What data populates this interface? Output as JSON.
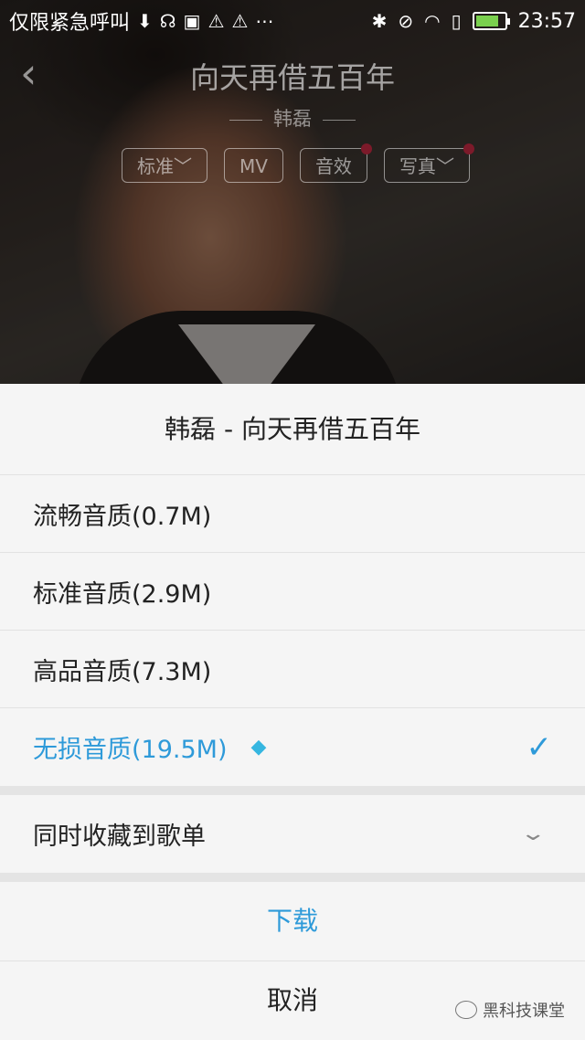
{
  "status_bar": {
    "notification_text": "仅限紧急呼叫",
    "time": "23:57",
    "icons": [
      "download-icon",
      "headset-icon",
      "image-icon",
      "warning-icon",
      "warning-icon",
      "more-icon",
      "bluetooth-icon",
      "mute-icon",
      "wifi-icon",
      "sim-icon",
      "battery-icon"
    ],
    "battery_level": 0.8
  },
  "player": {
    "song_title": "向天再借五百年",
    "artist": "韩磊",
    "pills": [
      {
        "label": "标准",
        "has_dropdown": true,
        "has_dot": false
      },
      {
        "label": "MV",
        "has_dropdown": false,
        "has_dot": false
      },
      {
        "label": "音效",
        "has_dropdown": false,
        "has_dot": true
      },
      {
        "label": "写真",
        "has_dropdown": true,
        "has_dot": true
      }
    ]
  },
  "sheet": {
    "title": "韩磊 - 向天再借五百年",
    "options": [
      {
        "label": "流畅音质(0.7M)",
        "selected": false
      },
      {
        "label": "标准音质(2.9M)",
        "selected": false
      },
      {
        "label": "高品音质(7.3M)",
        "selected": false
      },
      {
        "label": "无损音质(19.5M)",
        "selected": true,
        "badge_icon": "diamond-icon"
      }
    ],
    "collect_label": "同时收藏到歌单",
    "download_label": "下载",
    "cancel_label": "取消"
  },
  "watermark": "黑科技课堂",
  "colors": {
    "accent": "#2e9ad9",
    "sheet_bg": "#f5f5f5",
    "dot": "#7c1a2a"
  }
}
